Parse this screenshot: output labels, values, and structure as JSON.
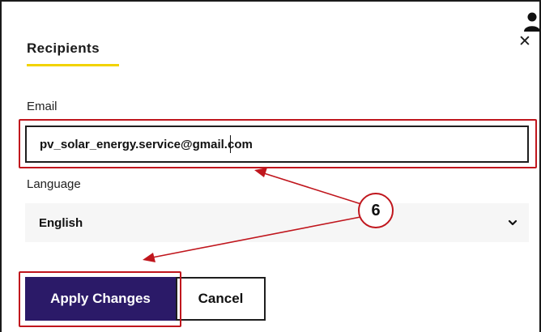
{
  "dialog": {
    "title": "Recipients",
    "close_icon": "close-icon",
    "user_icon": "user-icon"
  },
  "email": {
    "label": "Email",
    "value": "pv_solar_energy.service@gmail.com"
  },
  "language": {
    "label": "Language",
    "selected": "English",
    "icon": "chevron-down-icon"
  },
  "buttons": {
    "apply_label": "Apply Changes",
    "cancel_label": "Cancel"
  },
  "annotation": {
    "step_number": "6",
    "color": "#c0161d"
  },
  "colors": {
    "primary_button": "#2b1a68",
    "title_underline": "#f2d300",
    "highlight": "#c0161d"
  }
}
